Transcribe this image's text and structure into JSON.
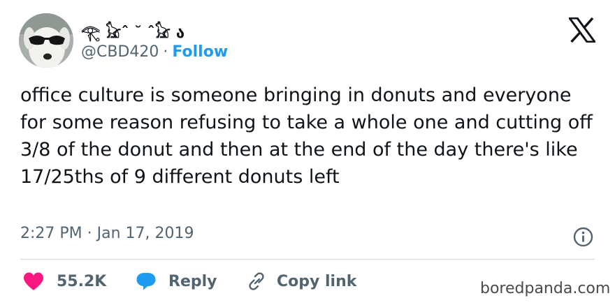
{
  "author": {
    "display_name": "𓂀 𓃠ˆ ˘ ˆ𓃠 ა",
    "handle": "@CBD420",
    "separator": "·",
    "follow_label": "Follow"
  },
  "tweet": {
    "text": "office culture is someone bringing in donuts and everyone for some reason refusing to take a whole one and cutting off 3/8 of the donut and then at the end of the day there's like 17/25ths of 9 different donuts left",
    "timestamp": "2:27 PM · Jan 17, 2019"
  },
  "actions": {
    "likes": "55.2K",
    "reply_label": "Reply",
    "copy_link_label": "Copy link"
  },
  "icons": {
    "brand": "x-logo-icon",
    "info": "info-icon",
    "like": "heart-icon",
    "reply": "speech-bubble-icon",
    "copy": "link-icon"
  },
  "colors": {
    "accent": "#1d9bf0",
    "like": "#f91880",
    "muted": "#536471",
    "text": "#0f1419"
  },
  "watermark": "boredpanda.com"
}
